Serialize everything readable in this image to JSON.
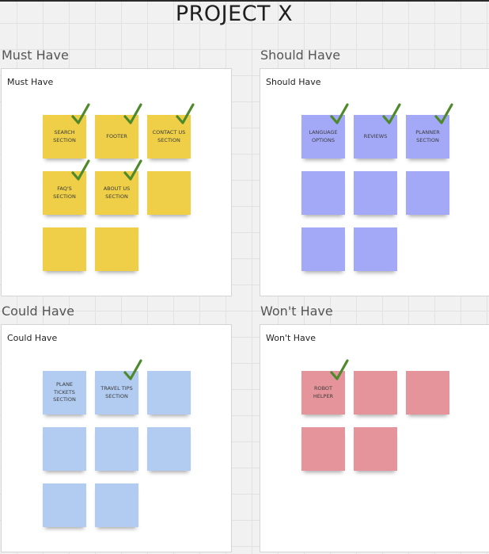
{
  "board_title": "PROJECT X",
  "colors": {
    "must": "#eecf47",
    "should": "#a3a9f7",
    "could": "#b1cbf1",
    "wont": "#e6949c",
    "check": "#4e8a2c"
  },
  "quadrants": [
    {
      "key": "must",
      "label": "Must Have",
      "frame_title": "Must Have",
      "notes": [
        {
          "text": "SEARCH\nSECTION",
          "checked": true
        },
        {
          "text": "FOOTER",
          "checked": true
        },
        {
          "text": "CONTACT US\nSECTION",
          "checked": true
        },
        {
          "text": "FAQ'S\nSECTION",
          "checked": true
        },
        {
          "text": "ABOUT US\nSECTION",
          "checked": true
        },
        {
          "text": "",
          "checked": false
        },
        {
          "text": "",
          "checked": false
        },
        {
          "text": "",
          "checked": false
        }
      ]
    },
    {
      "key": "should",
      "label": "Should Have",
      "frame_title": "Should Have",
      "notes": [
        {
          "text": "LANGUAGE\nOPTIONS",
          "checked": true
        },
        {
          "text": "REVIEWS",
          "checked": true
        },
        {
          "text": "PLANNER\nSECTION",
          "checked": true
        },
        {
          "text": "",
          "checked": false
        },
        {
          "text": "",
          "checked": false
        },
        {
          "text": "",
          "checked": false
        },
        {
          "text": "",
          "checked": false
        },
        {
          "text": "",
          "checked": false
        }
      ]
    },
    {
      "key": "could",
      "label": "Could Have",
      "frame_title": "Could Have",
      "notes": [
        {
          "text": "PLANE\nTICKETS\nSECTION",
          "checked": false
        },
        {
          "text": "TRAVEL TIPS\nSECTION",
          "checked": true
        },
        {
          "text": "",
          "checked": false
        },
        {
          "text": "",
          "checked": false
        },
        {
          "text": "",
          "checked": false
        },
        {
          "text": "",
          "checked": false
        },
        {
          "text": "",
          "checked": false
        },
        {
          "text": "",
          "checked": false
        }
      ]
    },
    {
      "key": "wont",
      "label": "Won't Have",
      "frame_title": "Won't Have",
      "notes": [
        {
          "text": "ROBOT\nHELPER",
          "checked": true
        },
        {
          "text": "",
          "checked": false
        },
        {
          "text": "",
          "checked": false
        },
        {
          "text": "",
          "checked": false
        },
        {
          "text": "",
          "checked": false
        }
      ]
    }
  ]
}
